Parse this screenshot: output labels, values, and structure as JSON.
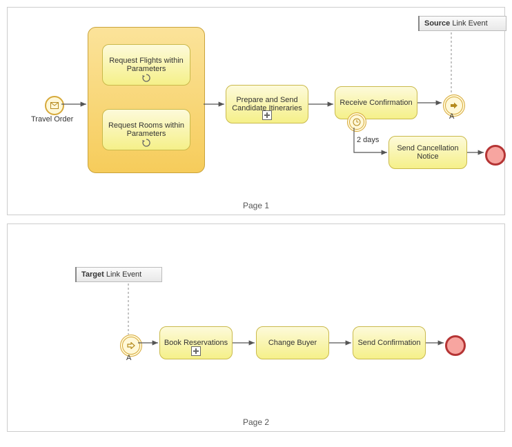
{
  "page1": {
    "label": "Page 1",
    "annotation": {
      "bold": "Source",
      "rest": " Link Event"
    },
    "startEventLabel": "Travel Order",
    "subprocess": {
      "task1": "Request Flights within Parameters",
      "task2": "Request Rooms within Parameters"
    },
    "taskPrepare": "Prepare and Send Candidate Itineraries",
    "taskReceive": "Receive Confirmation",
    "taskCancel": "Send Cancellation Notice",
    "timerLabel": "2 days",
    "linkLabel": "A"
  },
  "page2": {
    "label": "Page 2",
    "annotation": {
      "bold": "Target",
      "rest": " Link Event"
    },
    "linkLabel": "A",
    "taskBook": "Book Reservations",
    "taskChange": "Change Buyer",
    "taskSend": "Send Confirmation"
  },
  "chart_data": {
    "type": "diagram",
    "notation": "BPMN",
    "pages": [
      {
        "name": "Page 1",
        "elements": [
          {
            "id": "start",
            "type": "startEvent",
            "trigger": "message",
            "label": "Travel Order"
          },
          {
            "id": "sub",
            "type": "subProcess",
            "expanded": true,
            "children": [
              {
                "id": "reqFlights",
                "type": "task",
                "label": "Request Flights within Parameters",
                "loop": true
              },
              {
                "id": "reqRooms",
                "type": "task",
                "label": "Request Rooms within Parameters",
                "loop": true
              }
            ]
          },
          {
            "id": "prepare",
            "type": "task",
            "label": "Prepare and Send Candidate Itineraries",
            "marker": "subProcess"
          },
          {
            "id": "receive",
            "type": "task",
            "label": "Receive Confirmation",
            "boundary": {
              "type": "timer",
              "label": "2 days"
            }
          },
          {
            "id": "linkThrow",
            "type": "intermediateThrowEvent",
            "trigger": "link",
            "label": "A"
          },
          {
            "id": "cancel",
            "type": "task",
            "label": "Send Cancellation Notice"
          },
          {
            "id": "end1",
            "type": "endEvent"
          },
          {
            "id": "anno1",
            "type": "textAnnotation",
            "text": "Source Link Event",
            "attachedTo": "linkThrow"
          }
        ],
        "flows": [
          [
            "start",
            "sub"
          ],
          [
            "sub",
            "prepare"
          ],
          [
            "prepare",
            "receive"
          ],
          [
            "receive",
            "linkThrow"
          ],
          [
            "receive.boundary",
            "cancel"
          ],
          [
            "cancel",
            "end1"
          ]
        ]
      },
      {
        "name": "Page 2",
        "elements": [
          {
            "id": "linkCatch",
            "type": "intermediateCatchEvent",
            "trigger": "link",
            "label": "A"
          },
          {
            "id": "book",
            "type": "task",
            "label": "Book Reservations",
            "marker": "subProcess"
          },
          {
            "id": "change",
            "type": "task",
            "label": "Change Buyer"
          },
          {
            "id": "send",
            "type": "task",
            "label": "Send Confirmation"
          },
          {
            "id": "end2",
            "type": "endEvent"
          },
          {
            "id": "anno2",
            "type": "textAnnotation",
            "text": "Target Link Event",
            "attachedTo": "linkCatch"
          }
        ],
        "flows": [
          [
            "linkCatch",
            "book"
          ],
          [
            "book",
            "change"
          ],
          [
            "change",
            "send"
          ],
          [
            "send",
            "end2"
          ]
        ]
      }
    ]
  }
}
